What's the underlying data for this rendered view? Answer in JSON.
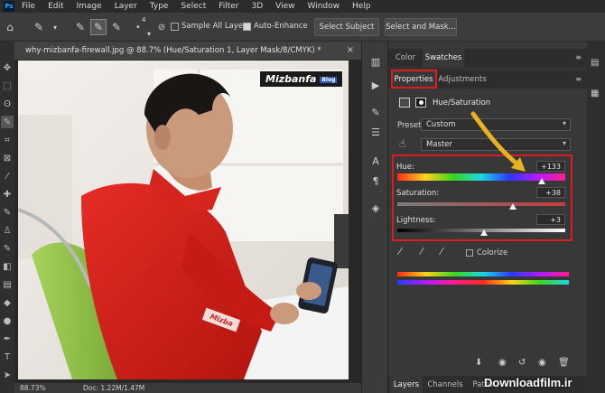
{
  "menu": {
    "items": [
      "File",
      "Edit",
      "Image",
      "Layer",
      "Type",
      "Select",
      "Filter",
      "3D",
      "View",
      "Window",
      "Help"
    ]
  },
  "options": {
    "brush_size": "4",
    "sample_all_layers": "Sample All Layers",
    "auto_enhance": "Auto-Enhance",
    "select_subject": "Select Subject",
    "select_and_mask": "Select and Mask..."
  },
  "document": {
    "tab_title": "why-mizbanfa-firewall.jpg @ 88.7% (Hue/Saturation 1, Layer Mask/8/CMYK) *",
    "close": "×",
    "logo_text": "Mizbanfa",
    "logo_sub": "Blog",
    "shirt_text": "Mizba"
  },
  "status": {
    "zoom": "88.73%",
    "doc": "Doc: 1.22M/1.47M"
  },
  "panel": {
    "top_tabs": [
      "Color",
      "Swatches"
    ],
    "prop_tabs": [
      "Properties",
      "Adjustments"
    ],
    "adjustment_name": "Hue/Saturation",
    "preset_label": "Preset:",
    "preset_value": "Custom",
    "channel_value": "Master",
    "hue_label": "Hue:",
    "hue_value": "+133",
    "hue_fraction": 0.862,
    "saturation_label": "Saturation:",
    "saturation_value": "+38",
    "saturation_fraction": 0.69,
    "lightness_label": "Lightness:",
    "lightness_value": "+3",
    "lightness_fraction": 0.515,
    "colorize_label": "Colorize",
    "bottom_tabs": [
      "Layers",
      "Channels",
      "Paths"
    ]
  },
  "watermark": "Downloadfilm.ir",
  "colors": {
    "highlight": "#d81e1e",
    "arrow": "#e8b321",
    "shirt": "#d3211f",
    "chair": "#8ec34a"
  }
}
